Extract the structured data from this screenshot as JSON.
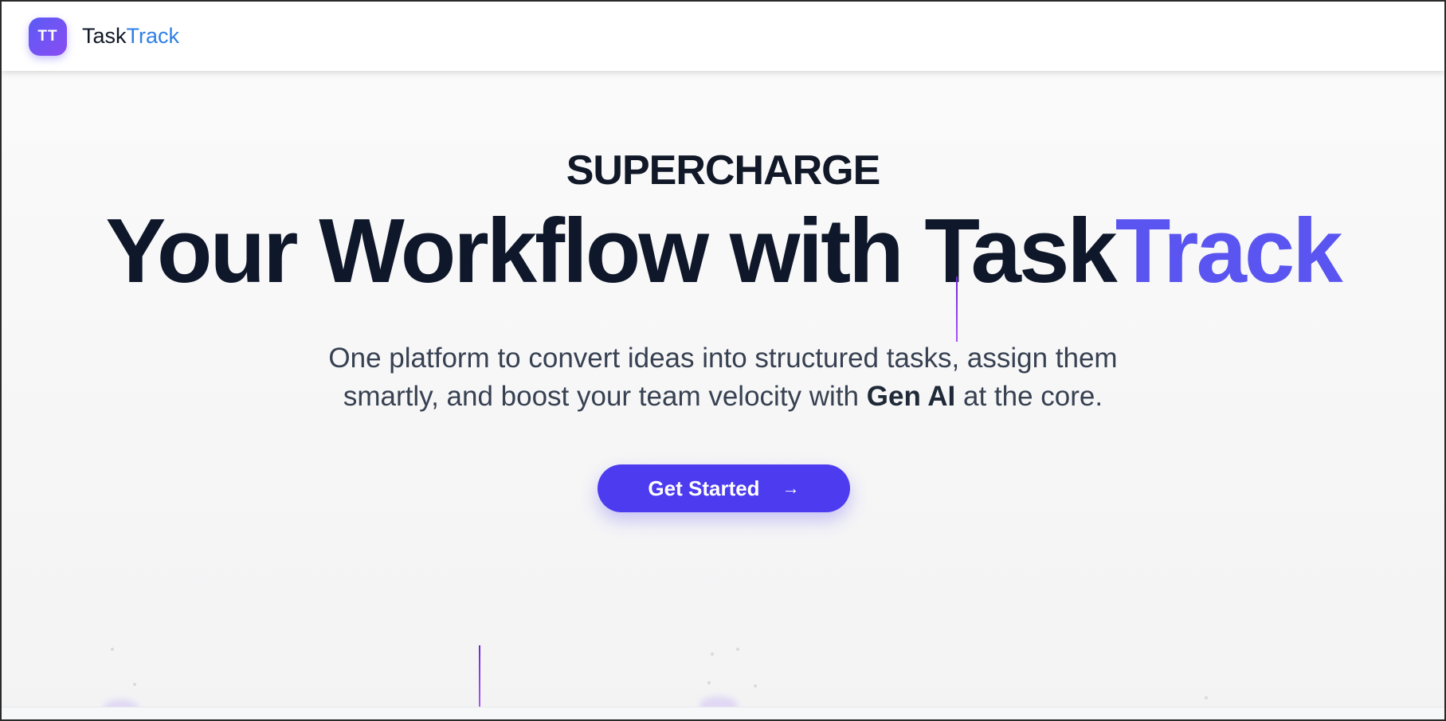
{
  "navbar": {
    "logo_initials": "TT",
    "brand_part1": "Task",
    "brand_part2": "Track"
  },
  "hero": {
    "eyebrow": "SUPERCHARGE",
    "headline_main": "Your Workflow with Task",
    "headline_accent": "Track",
    "subtext_line1": "One platform to convert ideas into structured tasks, assign them",
    "subtext_line2_pre": "smartly, and boost your team velocity with ",
    "subtext_line2_bold": "Gen AI",
    "subtext_line2_post": " at the core.",
    "cta_label": "Get Started",
    "cta_icon": "arrow-right-icon"
  },
  "colors": {
    "accent": "#5a55f0",
    "button": "#4c3bef",
    "brand_blue": "#2f7fe6",
    "text_dark": "#0f172a"
  }
}
